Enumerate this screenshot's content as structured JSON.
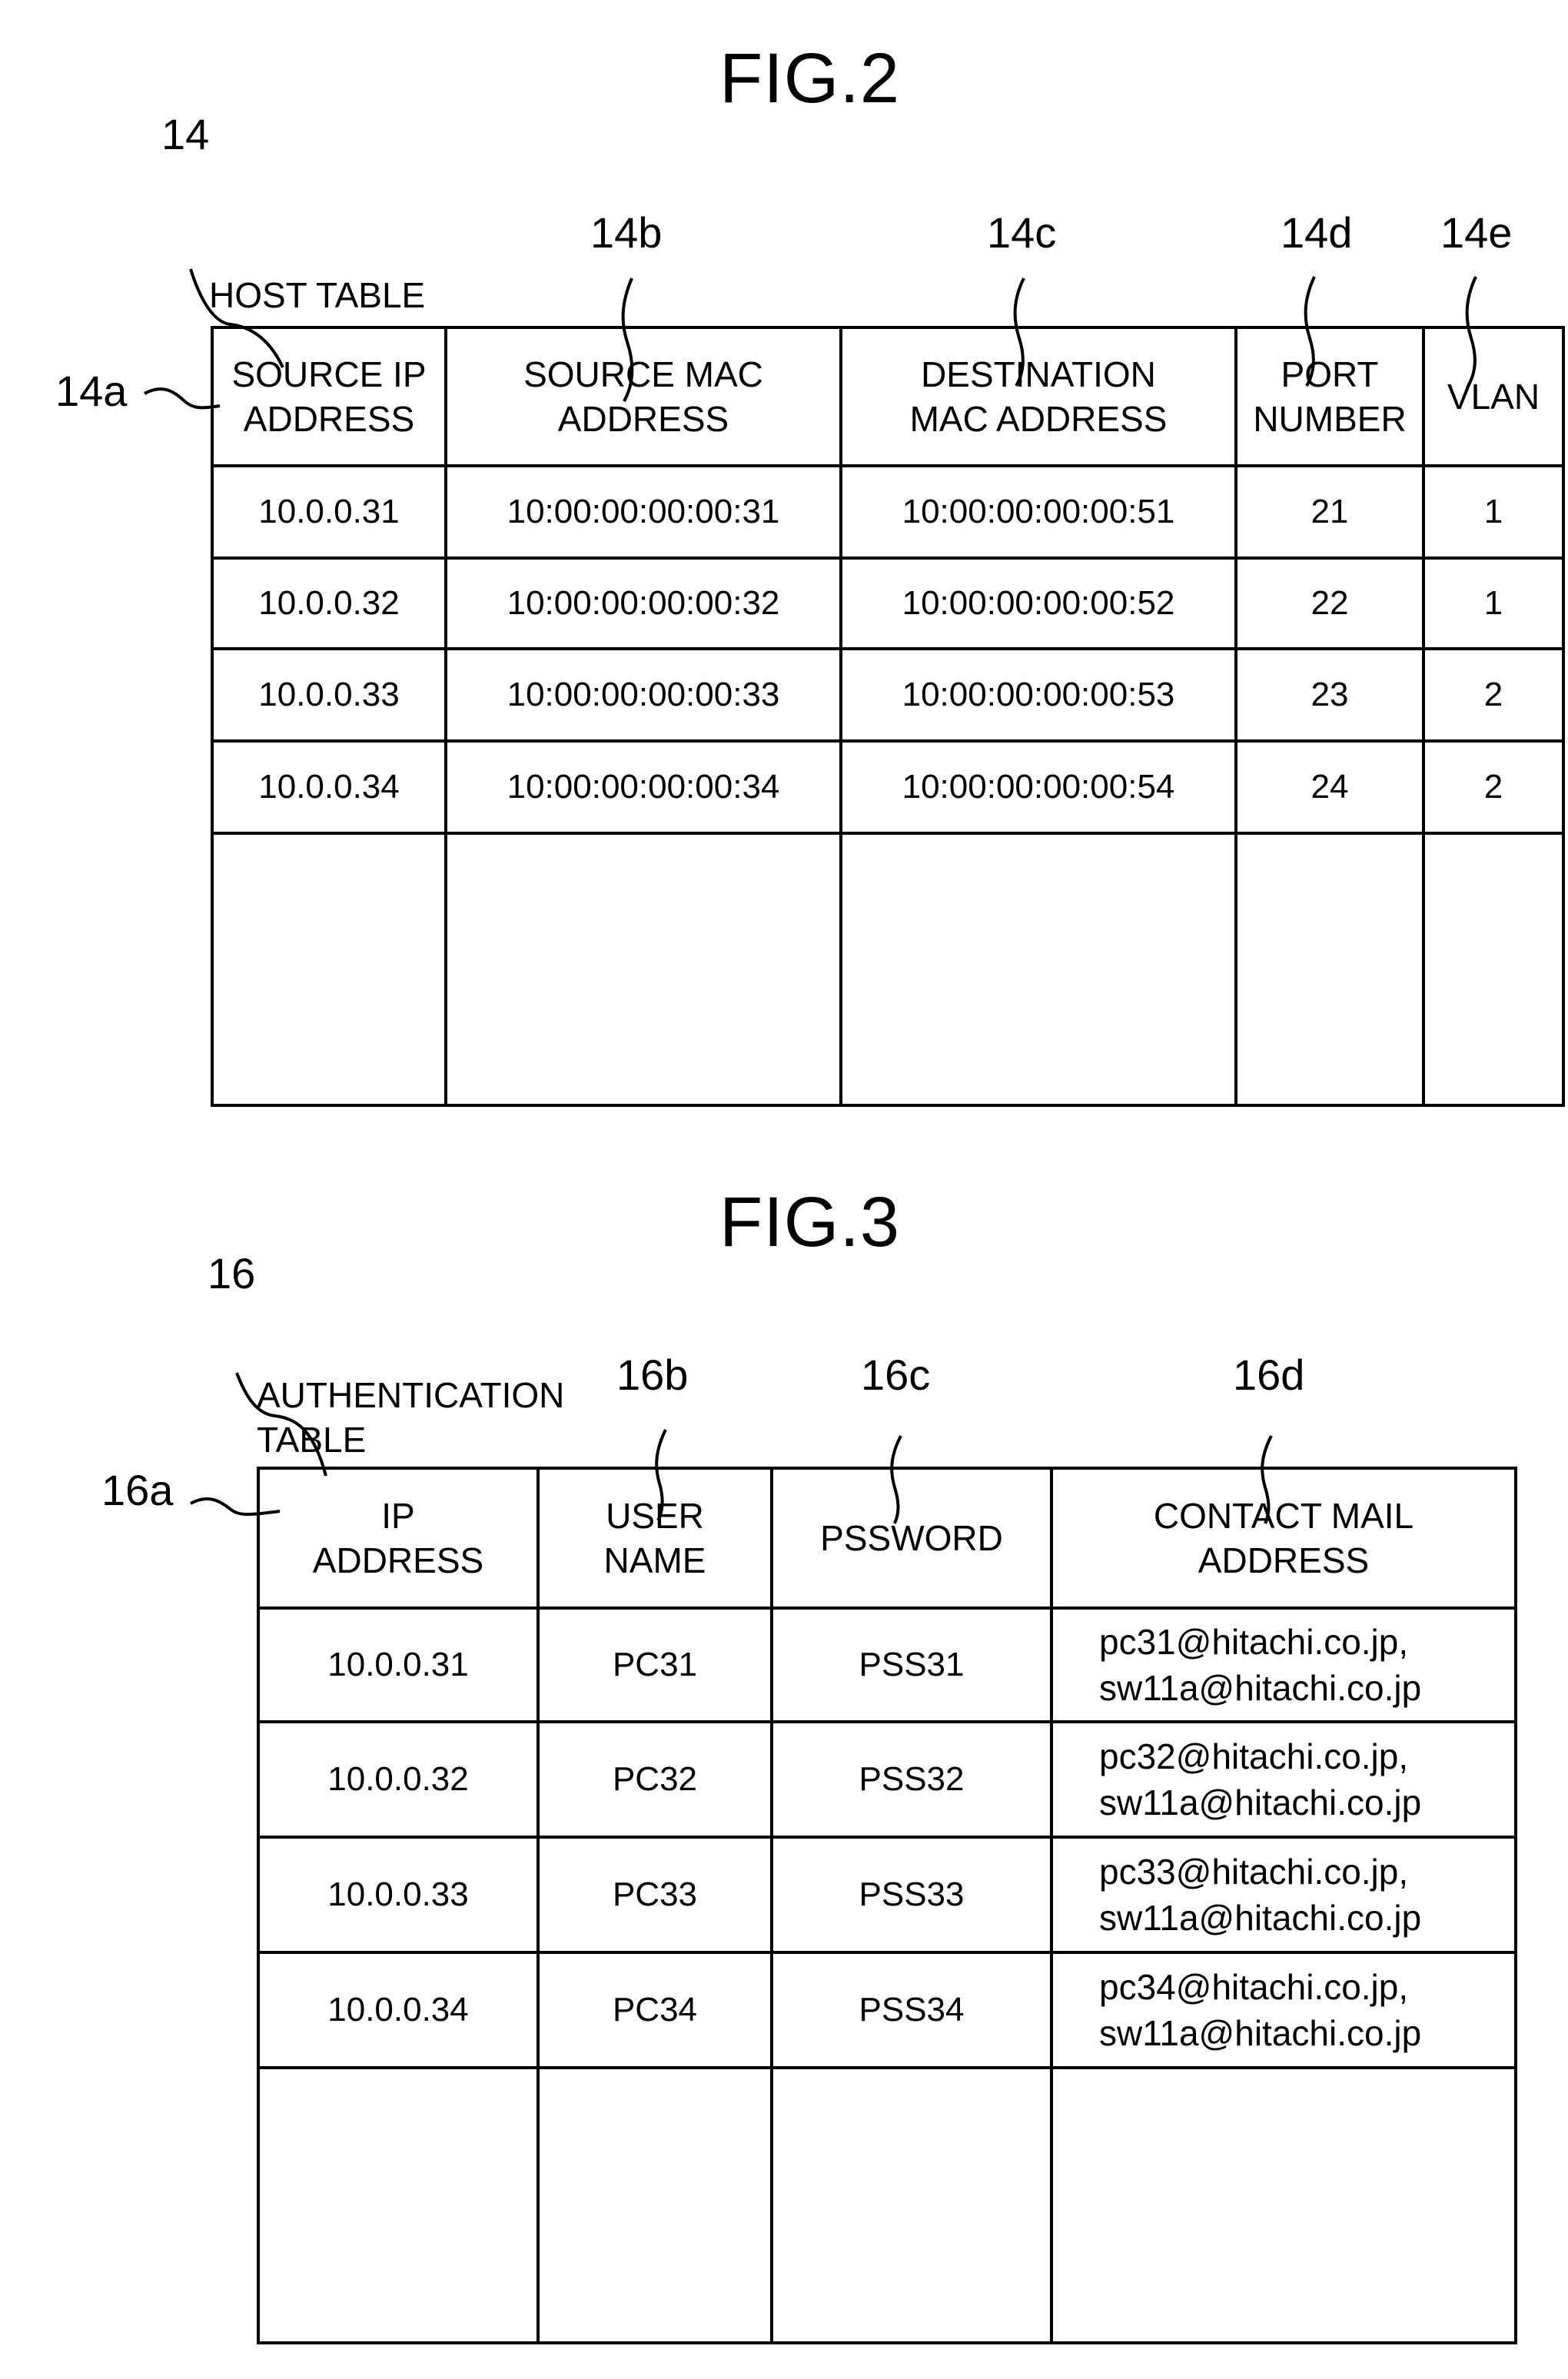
{
  "fig2": {
    "title": "FIG.2",
    "ref_main": "14",
    "caption": "HOST TABLE",
    "col_refs": [
      "14a",
      "14b",
      "14c",
      "14d",
      "14e"
    ],
    "headers": [
      [
        "SOURCE IP",
        "ADDRESS"
      ],
      [
        "SOURCE MAC",
        "ADDRESS"
      ],
      [
        "DESTINATION",
        "MAC ADDRESS"
      ],
      [
        "PORT",
        "NUMBER"
      ],
      [
        "VLAN"
      ]
    ],
    "rows": [
      [
        "10.0.0.31",
        "10:00:00:00:00:31",
        "10:00:00:00:00:51",
        "21",
        "1"
      ],
      [
        "10.0.0.32",
        "10:00:00:00:00:32",
        "10:00:00:00:00:52",
        "22",
        "1"
      ],
      [
        "10.0.0.33",
        "10:00:00:00:00:33",
        "10:00:00:00:00:53",
        "23",
        "2"
      ],
      [
        "10.0.0.34",
        "10:00:00:00:00:34",
        "10:00:00:00:00:54",
        "24",
        "2"
      ]
    ]
  },
  "fig3": {
    "title": "FIG.3",
    "ref_main": "16",
    "caption": [
      "AUTHENTICATION",
      "TABLE"
    ],
    "col_refs": [
      "16a",
      "16b",
      "16c",
      "16d"
    ],
    "headers": [
      [
        "IP",
        "ADDRESS"
      ],
      [
        "USER",
        "NAME"
      ],
      [
        "PSSWORD"
      ],
      [
        "CONTACT MAIL",
        "ADDRESS"
      ]
    ],
    "rows": [
      [
        "10.0.0.31",
        "PC31",
        "PSS31",
        [
          "pc31@hitachi.co.jp,",
          "sw11a@hitachi.co.jp"
        ]
      ],
      [
        "10.0.0.32",
        "PC32",
        "PSS32",
        [
          "pc32@hitachi.co.jp,",
          "sw11a@hitachi.co.jp"
        ]
      ],
      [
        "10.0.0.33",
        "PC33",
        "PSS33",
        [
          "pc33@hitachi.co.jp,",
          "sw11a@hitachi.co.jp"
        ]
      ],
      [
        "10.0.0.34",
        "PC34",
        "PSS34",
        [
          "pc34@hitachi.co.jp,",
          "sw11a@hitachi.co.jp"
        ]
      ]
    ]
  }
}
